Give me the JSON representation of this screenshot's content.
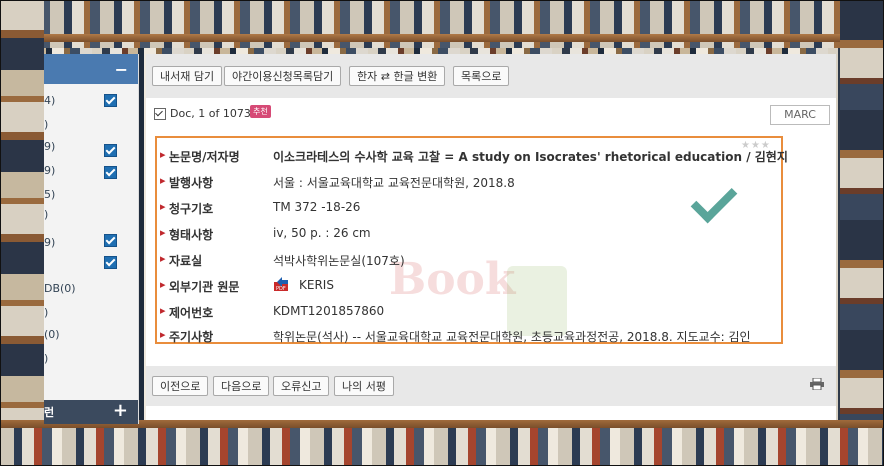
{
  "sidebar": {
    "collapse_glyph": "−",
    "expand_glyph": "+",
    "footer_label": "런",
    "rows": [
      {
        "text": "4)",
        "checked": true
      },
      {
        "text": ")",
        "checked": false
      },
      {
        "text": "9)",
        "checked": true
      },
      {
        "text": "9)",
        "checked": true
      },
      {
        "text": "5)",
        "checked": false
      },
      {
        "text": ")",
        "checked": true
      },
      {
        "text": "9)",
        "checked": true
      },
      {
        "text": "DB(0)",
        "checked": false
      },
      {
        "text": ")",
        "checked": false
      },
      {
        "text": "(0)",
        "checked": false
      },
      {
        "text": ")",
        "checked": false
      }
    ]
  },
  "toolbar": {
    "export_label": "내서재 담기",
    "night_loan_label": "야간이용신청목록담기",
    "hanja_label": "한자 ⇄ 한글 변환",
    "list_label": "목록으로"
  },
  "doc": {
    "label": "Doc, 1 of 1073",
    "badge": "추천",
    "marc_label": "MARC"
  },
  "record": {
    "rows": [
      {
        "label": "논문명/저자명",
        "value": "이소크라테스의 수사학 교육 고찰 = A study on Isocrates' rhetorical education / 김현지"
      },
      {
        "label": "발행사항",
        "value": "서울 : 서울교육대학교 교육전문대학원, 2018.8"
      },
      {
        "label": "청구기호",
        "value": "TM 372 -18-26"
      },
      {
        "label": "형태사항",
        "value": "iv, 50 p. : 26 cm"
      },
      {
        "label": "자료실",
        "value": "석박사학위논문실(107호)"
      },
      {
        "label": "외부기관 원문",
        "value": "KERIS"
      },
      {
        "label": "제어번호",
        "value": "KDMT1201857860"
      },
      {
        "label": "주기사항",
        "value": "학위논문(석사) -- 서울교육대학교 교육전문대학원, 초등교육과정전공, 2018.8. 지도교수: 김인"
      }
    ],
    "watermark": "Book",
    "stars": "★★★"
  },
  "bottom": {
    "prev_label": "이전으로",
    "next_label": "다음으로",
    "report_label": "오류신고",
    "my_shelf_label": "나의 서평"
  },
  "colors": {
    "accent_blue": "#4a7ab0",
    "record_border": "#e98d3c",
    "label_marker": "#c0282d",
    "checkmark": "#5aa59a"
  }
}
